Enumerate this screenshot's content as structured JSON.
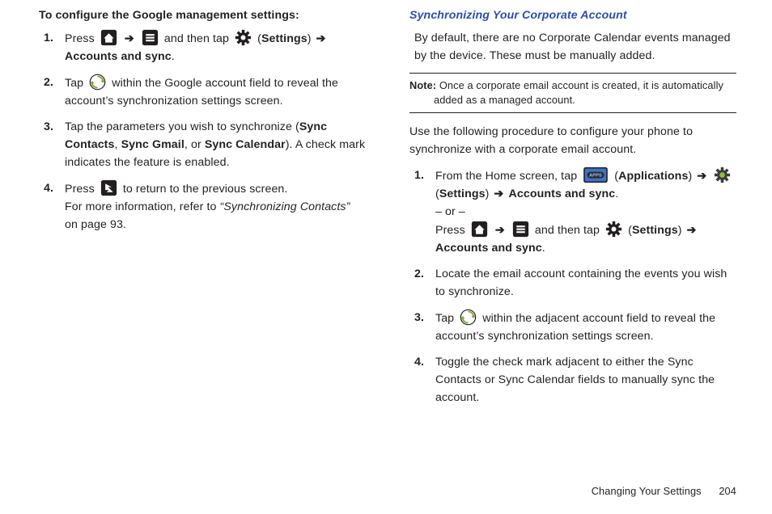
{
  "left": {
    "heading": "To configure the Google management settings:",
    "steps": [
      {
        "n": "1.",
        "parts": [
          {
            "t": "Press "
          },
          {
            "icon": "home"
          },
          {
            "arrow": true
          },
          {
            "icon": "menu"
          },
          {
            "t": " and then tap "
          },
          {
            "icon": "gear"
          },
          {
            "t": " ("
          },
          {
            "b": "Settings"
          },
          {
            "t": ") "
          },
          {
            "arrow": true
          },
          {
            "t": " "
          },
          {
            "b": "Accounts and sync"
          },
          {
            "t": "."
          }
        ]
      },
      {
        "n": "2.",
        "parts": [
          {
            "t": "Tap "
          },
          {
            "icon": "sync"
          },
          {
            "t": " within the Google account field to reveal the account’s synchronization settings screen."
          }
        ]
      },
      {
        "n": "3.",
        "parts": [
          {
            "t": "Tap the parameters you wish to synchronize ("
          },
          {
            "b": "Sync Contacts"
          },
          {
            "t": ", "
          },
          {
            "b": "Sync Gmail"
          },
          {
            "t": ", or "
          },
          {
            "b": "Sync Calendar"
          },
          {
            "t": "). A check mark indicates the feature is enabled."
          }
        ]
      },
      {
        "n": "4.",
        "parts": [
          {
            "t": "Press "
          },
          {
            "icon": "back"
          },
          {
            "t": " to return to the previous screen."
          },
          {
            "br": true
          },
          {
            "t": "For more information, refer to "
          },
          {
            "i": "“Synchronizing Contacts”"
          },
          {
            "t": " on page 93."
          }
        ]
      }
    ]
  },
  "right": {
    "heading": "Synchronizing Your Corporate Account",
    "intro": "By default, there are no Corporate Calendar events managed by the device. These must be manually added.",
    "note_label": "Note:",
    "note_body": "Once a corporate email account is created, it is automatically added as a managed account.",
    "lead": "Use the following procedure to configure your phone to synchronize with a corporate email account.",
    "steps": [
      {
        "n": "1.",
        "parts": [
          {
            "t": "From the Home screen, tap "
          },
          {
            "icon": "apps"
          },
          {
            "t": " ("
          },
          {
            "b": "Applications"
          },
          {
            "t": ") "
          },
          {
            "arrow": true
          },
          {
            "t": " "
          },
          {
            "icon": "gear-green"
          },
          {
            "t": " ("
          },
          {
            "b": "Settings"
          },
          {
            "t": ") "
          },
          {
            "arrow": true
          },
          {
            "t": " "
          },
          {
            "b": "Accounts and sync"
          },
          {
            "t": "."
          },
          {
            "br": true
          },
          {
            "t": "– or –"
          },
          {
            "br": true
          },
          {
            "t": "Press "
          },
          {
            "icon": "home"
          },
          {
            "arrow": true
          },
          {
            "icon": "menu"
          },
          {
            "t": " and then tap "
          },
          {
            "icon": "gear"
          },
          {
            "t": " ("
          },
          {
            "b": "Settings"
          },
          {
            "t": ") "
          },
          {
            "arrow": true
          },
          {
            "t": " "
          },
          {
            "b": "Accounts and sync"
          },
          {
            "t": "."
          }
        ]
      },
      {
        "n": "2.",
        "parts": [
          {
            "t": "Locate the email account containing the events you wish to synchronize."
          }
        ]
      },
      {
        "n": "3.",
        "parts": [
          {
            "t": "Tap "
          },
          {
            "icon": "sync"
          },
          {
            "t": " within the adjacent account field to reveal the account’s synchronization settings screen."
          }
        ]
      },
      {
        "n": "4.",
        "parts": [
          {
            "t": "Toggle the check mark adjacent to either the Sync Contacts or Sync Calendar fields to manually sync the account."
          }
        ]
      }
    ]
  },
  "footer": {
    "section": "Changing Your Settings",
    "page": "204"
  },
  "glyphs": {
    "arrow": "➔"
  }
}
